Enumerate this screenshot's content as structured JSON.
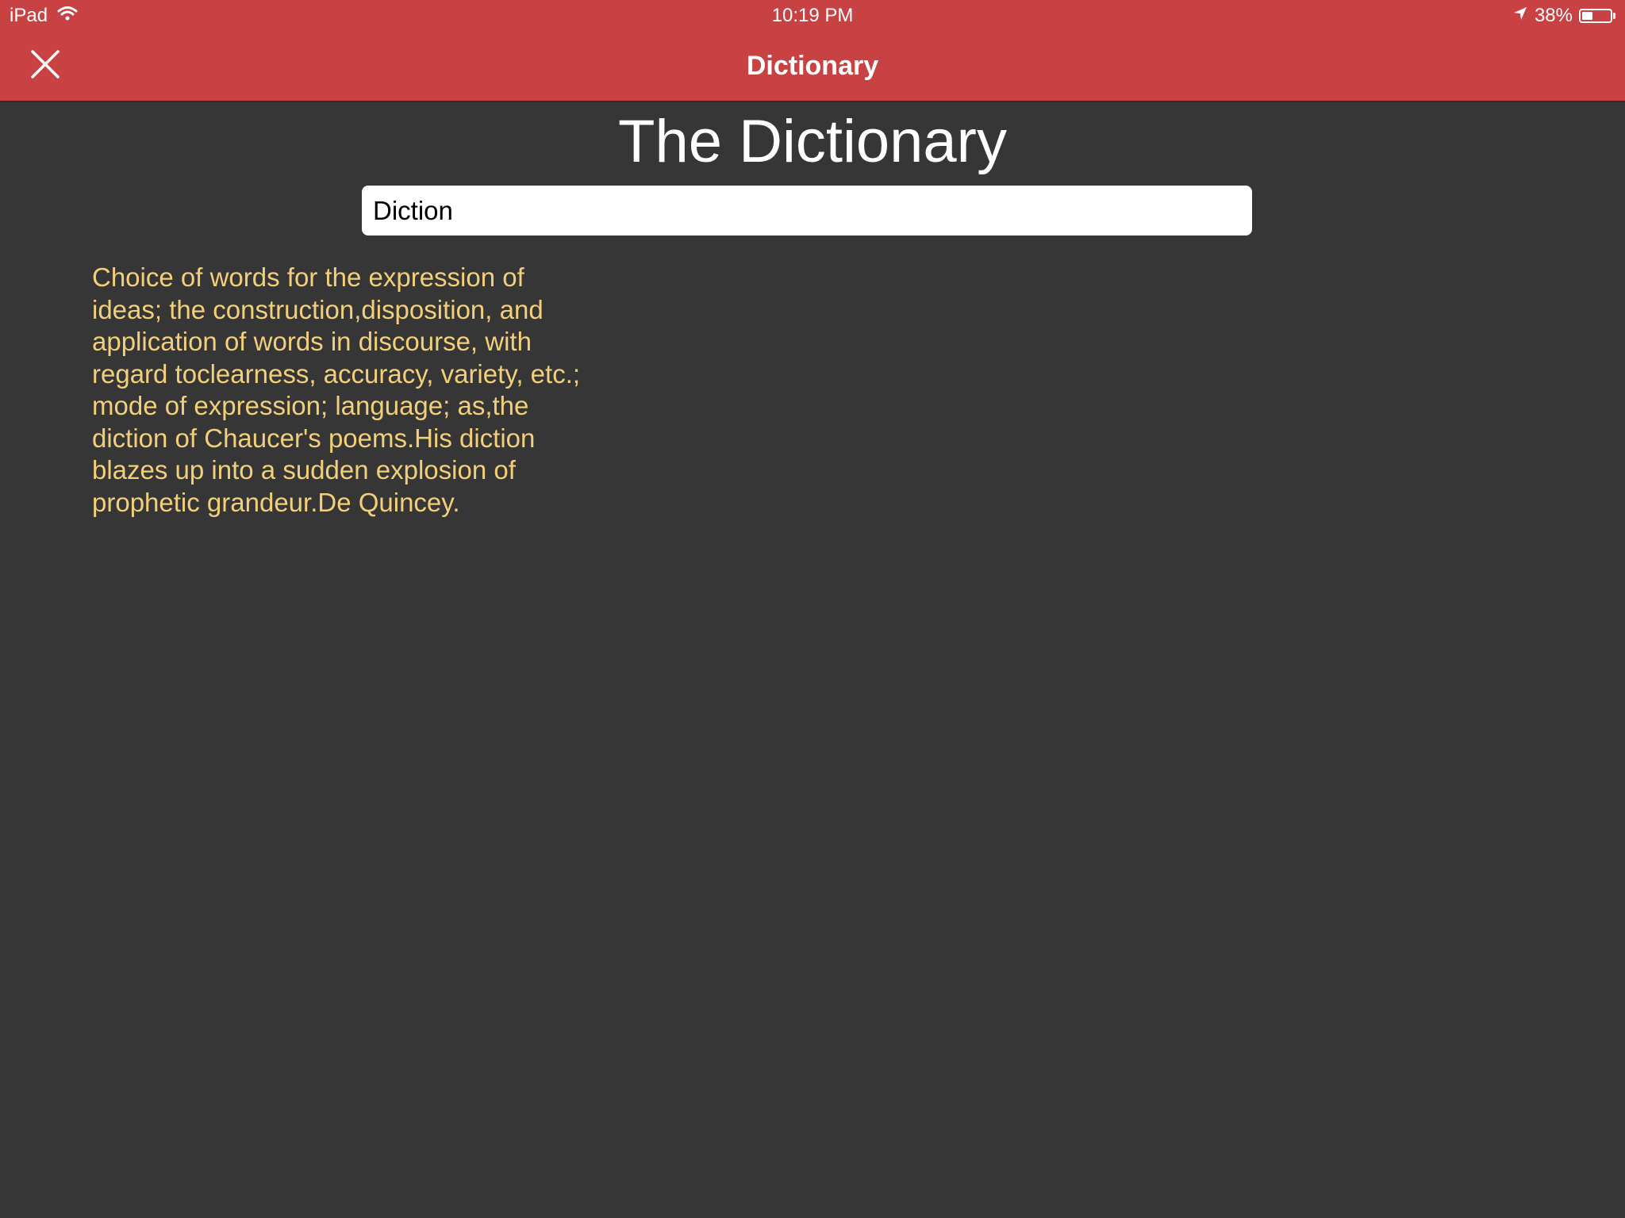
{
  "status_bar": {
    "device": "iPad",
    "time": "10:19 PM",
    "battery_percent": "38%",
    "battery_level": 0.38,
    "icons": [
      "wifi-icon",
      "location-arrow-icon",
      "battery-icon"
    ]
  },
  "nav": {
    "title": "Dictionary",
    "close_icon": "close-icon"
  },
  "main": {
    "title": "The Dictionary",
    "search_value": "Diction",
    "definition": "Choice of words for the expression of ideas; the construction,disposition, and application of words in discourse, with regard toclearness, accuracy, variety, etc.; mode of expression; language; as,the diction of Chaucer's poems.His diction blazes up into a sudden explosion of prophetic grandeur.De Quincey."
  },
  "colors": {
    "header": "#c84244",
    "background": "#363636",
    "definition_text": "#f2cf7a",
    "title_text": "#ffffff"
  }
}
